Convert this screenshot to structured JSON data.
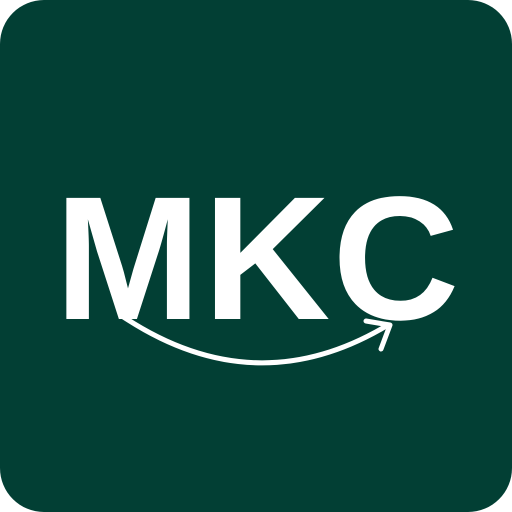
{
  "logo": {
    "text": "MKC",
    "background_color": "#023f34",
    "foreground_color": "#ffffff",
    "swoosh_icon": "curved-arrow-icon"
  }
}
